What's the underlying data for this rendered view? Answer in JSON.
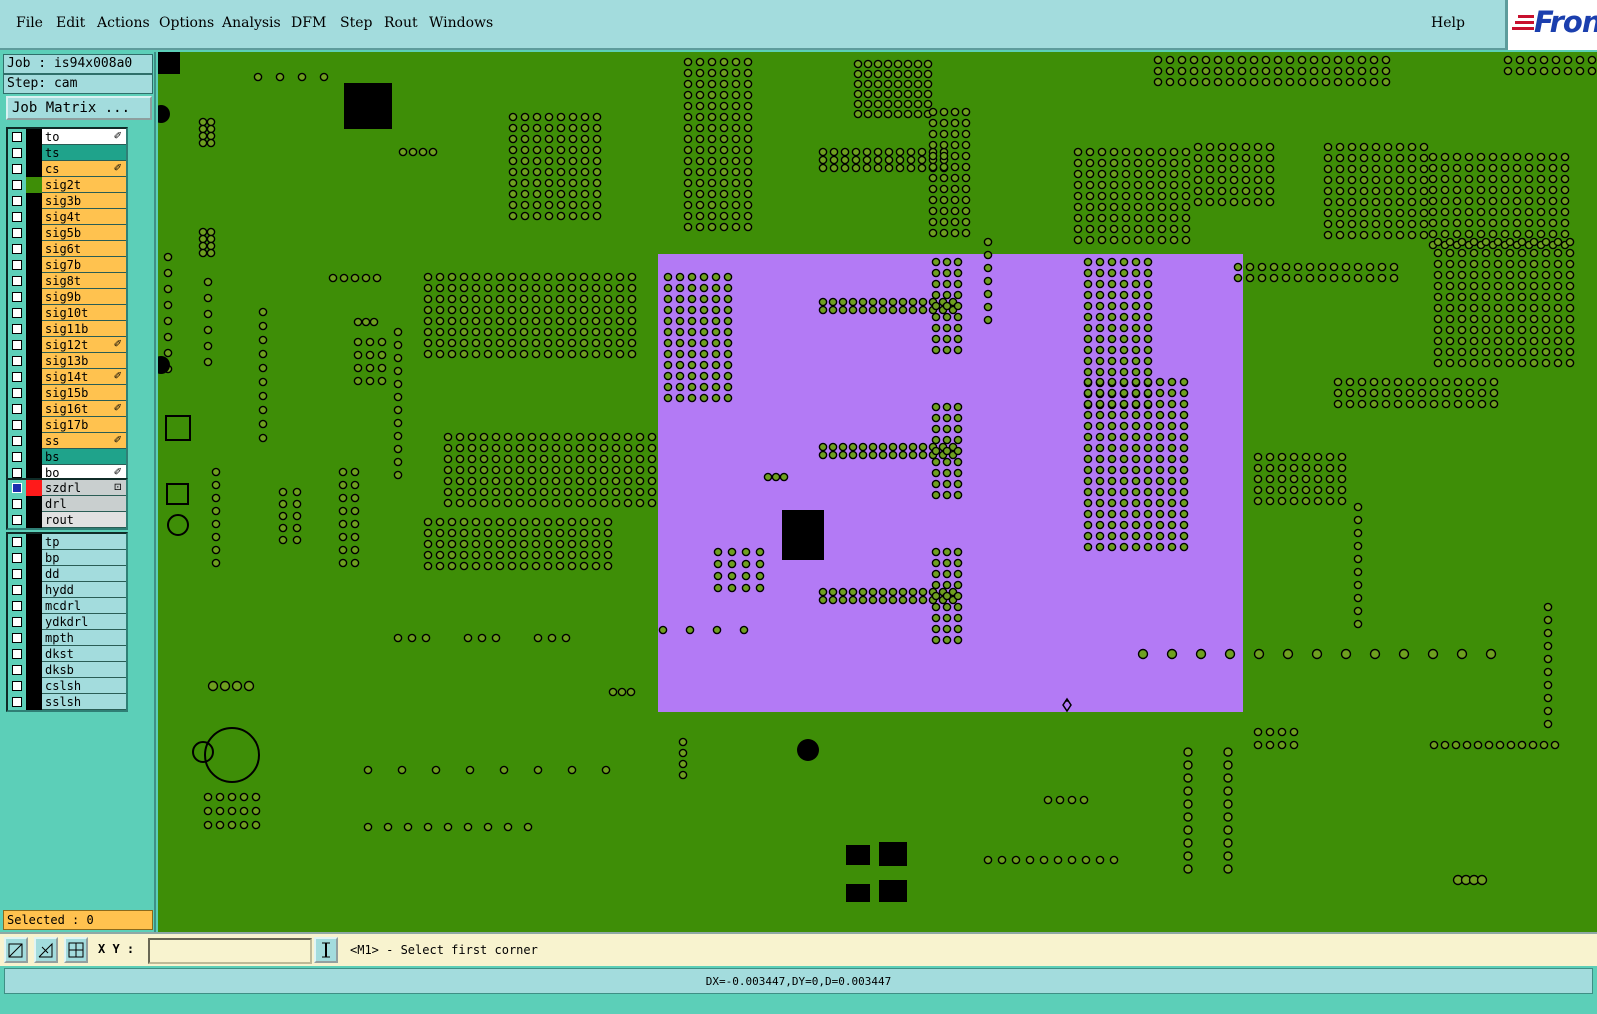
{
  "menubar": {
    "items": [
      {
        "label": "File",
        "name": "menu-file"
      },
      {
        "label": "Edit",
        "name": "menu-edit"
      },
      {
        "label": "Actions",
        "name": "menu-actions"
      },
      {
        "label": "Options",
        "name": "menu-options"
      },
      {
        "label": "Analysis",
        "name": "menu-analysis"
      },
      {
        "label": "DFM",
        "name": "menu-dfm"
      },
      {
        "label": "Step",
        "name": "menu-step"
      },
      {
        "label": "Rout",
        "name": "menu-rout"
      },
      {
        "label": "Windows",
        "name": "menu-windows"
      }
    ],
    "help": "Help",
    "logo_text": "Fron"
  },
  "job": {
    "job_line": "Job : is94x008a0",
    "step_line": "Step: cam",
    "matrix_button": "Job Matrix ..."
  },
  "layers": {
    "board": [
      {
        "name": "to",
        "color": "#ffffff",
        "mark": "✐"
      },
      {
        "name": "ts",
        "color": "#1fa38b",
        "mark": ""
      },
      {
        "name": "cs",
        "color": "#ffc24f",
        "mark": "✐"
      },
      {
        "name": "sig2t",
        "color": "#ffc24f",
        "mark": "",
        "active": true
      },
      {
        "name": "sig3b",
        "color": "#ffc24f",
        "mark": ""
      },
      {
        "name": "sig4t",
        "color": "#ffc24f",
        "mark": ""
      },
      {
        "name": "sig5b",
        "color": "#ffc24f",
        "mark": ""
      },
      {
        "name": "sig6t",
        "color": "#ffc24f",
        "mark": ""
      },
      {
        "name": "sig7b",
        "color": "#ffc24f",
        "mark": ""
      },
      {
        "name": "sig8t",
        "color": "#ffc24f",
        "mark": ""
      },
      {
        "name": "sig9b",
        "color": "#ffc24f",
        "mark": ""
      },
      {
        "name": "sig10t",
        "color": "#ffc24f",
        "mark": ""
      },
      {
        "name": "sig11b",
        "color": "#ffc24f",
        "mark": ""
      },
      {
        "name": "sig12t",
        "color": "#ffc24f",
        "mark": "✐"
      },
      {
        "name": "sig13b",
        "color": "#ffc24f",
        "mark": ""
      },
      {
        "name": "sig14t",
        "color": "#ffc24f",
        "mark": "✐"
      },
      {
        "name": "sig15b",
        "color": "#ffc24f",
        "mark": ""
      },
      {
        "name": "sig16t",
        "color": "#ffc24f",
        "mark": "✐"
      },
      {
        "name": "sig17b",
        "color": "#ffc24f",
        "mark": ""
      },
      {
        "name": "ss",
        "color": "#ffc24f",
        "mark": "✐"
      },
      {
        "name": "bs",
        "color": "#1fa38b",
        "mark": ""
      },
      {
        "name": "bo",
        "color": "#ffffff",
        "mark": "✐"
      }
    ],
    "drill": [
      {
        "name": "szdrl",
        "color": "#c9cfcf",
        "mark": "⊡",
        "selected": true
      },
      {
        "name": "drl",
        "color": "#c9cfcf",
        "mark": ""
      },
      {
        "name": "rout",
        "color": "#e1e1e1",
        "mark": ""
      }
    ],
    "misc": [
      {
        "name": "tp",
        "color": "#a3dcdd",
        "mark": ""
      },
      {
        "name": "bp",
        "color": "#a3dcdd",
        "mark": ""
      },
      {
        "name": "dd",
        "color": "#a3dcdd",
        "mark": ""
      },
      {
        "name": "hydd",
        "color": "#a3dcdd",
        "mark": ""
      },
      {
        "name": "mcdrl",
        "color": "#a3dcdd",
        "mark": ""
      },
      {
        "name": "ydkdrl",
        "color": "#a3dcdd",
        "mark": ""
      },
      {
        "name": "mpth",
        "color": "#a3dcdd",
        "mark": ""
      },
      {
        "name": "dkst",
        "color": "#a3dcdd",
        "mark": ""
      },
      {
        "name": "dksb",
        "color": "#a3dcdd",
        "mark": ""
      },
      {
        "name": "cslsh",
        "color": "#a3dcdd",
        "mark": ""
      },
      {
        "name": "sslsh",
        "color": "#a3dcdd",
        "mark": ""
      }
    ],
    "selected_count": "Selected : 0"
  },
  "colors": {
    "board_green": "#3e8e07",
    "highlight_purple": "#b37af5",
    "pad_fill": "#6fa020",
    "panel": "#5ccfb8"
  },
  "toolbar": {
    "xy_label": "X Y :",
    "xy_value": "",
    "prompt": "<M1> - Select first corner"
  },
  "status": {
    "measurement": "DX=-0.003447,DY=0,D=0.003447"
  }
}
